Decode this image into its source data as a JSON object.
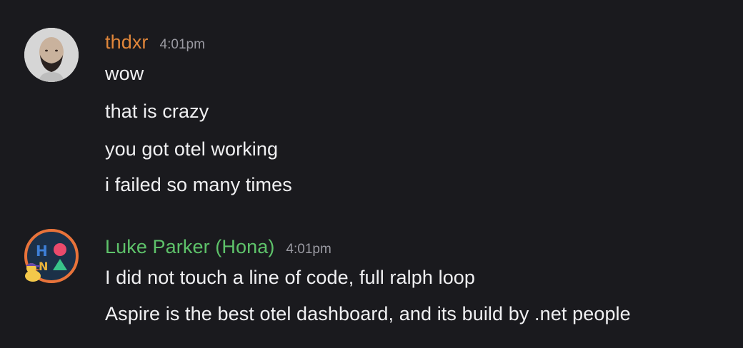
{
  "messages": [
    {
      "author": "thdxr",
      "author_color": "#e0863a",
      "time": "4:01pm",
      "lines": [
        "wow",
        "that is crazy",
        "you got otel working",
        "i failed so many times"
      ]
    },
    {
      "author": "Luke Parker (Hona)",
      "author_color": "#5ec26a",
      "time": "4:01pm",
      "lines": [
        "I did not touch a line of code, full ralph loop",
        "Aspire is the best otel dashboard, and its build by .net people"
      ]
    }
  ],
  "colors": {
    "background": "#1a1a1e",
    "text": "#f0f0f2",
    "timestamp": "#9a9aa2"
  }
}
